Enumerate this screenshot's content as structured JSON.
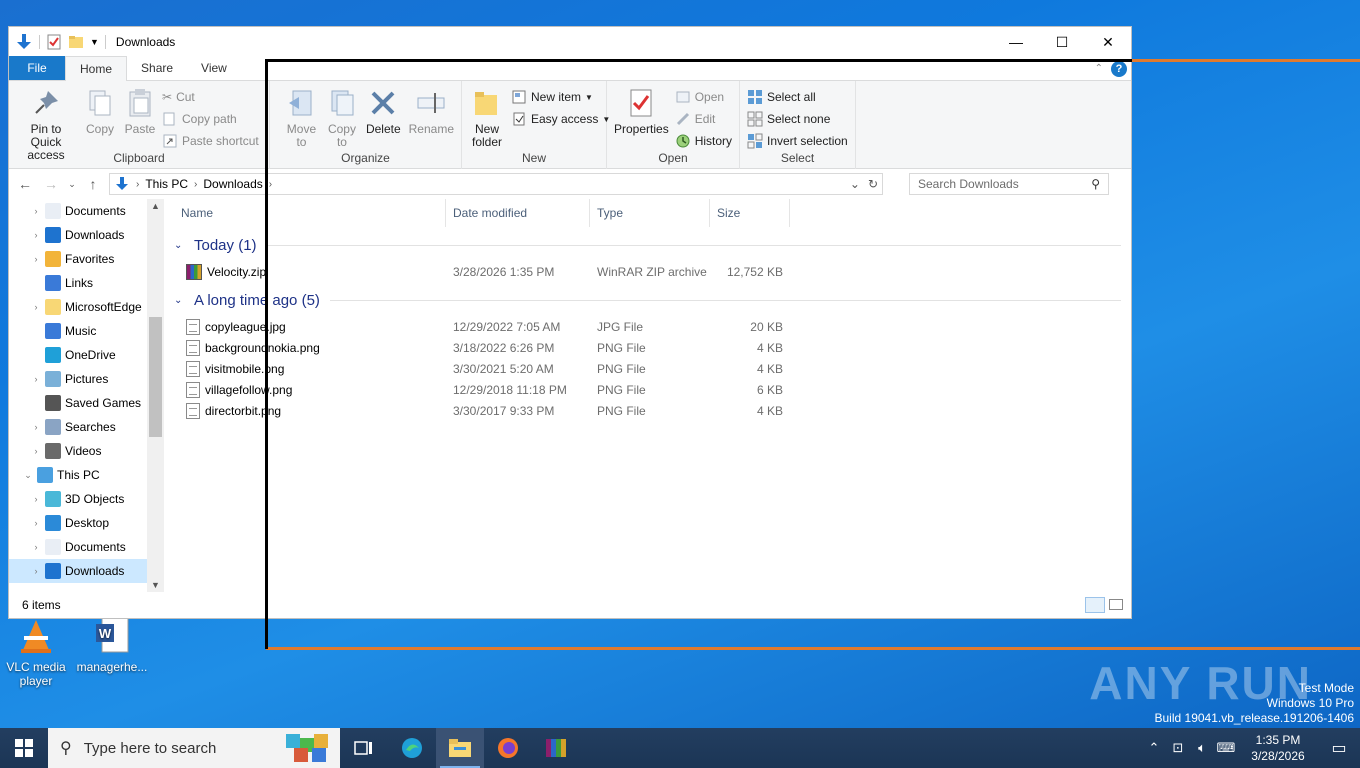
{
  "desktop": {
    "icons": [
      {
        "label": "VLC media player"
      },
      {
        "label": "managerhe..."
      }
    ],
    "watermark": {
      "brand": "ANY RUN",
      "line1": "Test Mode",
      "line2": "Windows 10 Pro",
      "line3": "Build 19041.vb_release.191206-1406"
    }
  },
  "window": {
    "title": "Downloads",
    "controls": {
      "minimize": "—",
      "maximize": "☐",
      "close": "✕"
    },
    "tabs": {
      "file": "File",
      "home": "Home",
      "share": "Share",
      "view": "View"
    },
    "help": "?"
  },
  "ribbon": {
    "clipboard": {
      "label": "Clipboard",
      "pin": "Pin to Quick access",
      "copy": "Copy",
      "paste": "Paste",
      "cut": "Cut",
      "copy_path": "Copy path",
      "paste_shortcut": "Paste shortcut"
    },
    "organize": {
      "label": "Organize",
      "move_to": "Move to",
      "copy_to": "Copy to",
      "delete": "Delete",
      "rename": "Rename"
    },
    "new": {
      "label": "New",
      "new_folder": "New folder",
      "new_item": "New item",
      "easy_access": "Easy access"
    },
    "open": {
      "label": "Open",
      "properties": "Properties",
      "open": "Open",
      "edit": "Edit",
      "history": "History"
    },
    "select": {
      "label": "Select",
      "select_all": "Select all",
      "select_none": "Select none",
      "invert": "Invert selection"
    }
  },
  "address": {
    "crumbs": [
      "This PC",
      "Downloads"
    ],
    "search_placeholder": "Search Downloads"
  },
  "nav": {
    "items": [
      {
        "label": "Documents",
        "expand": "›",
        "indent": 1
      },
      {
        "label": "Downloads",
        "expand": "›",
        "indent": 1
      },
      {
        "label": "Favorites",
        "expand": "›",
        "indent": 1
      },
      {
        "label": "Links",
        "expand": "",
        "indent": 1
      },
      {
        "label": "MicrosoftEdge",
        "expand": "›",
        "indent": 1
      },
      {
        "label": "Music",
        "expand": "",
        "indent": 1
      },
      {
        "label": "OneDrive",
        "expand": "",
        "indent": 1
      },
      {
        "label": "Pictures",
        "expand": "›",
        "indent": 1
      },
      {
        "label": "Saved Games",
        "expand": "",
        "indent": 1
      },
      {
        "label": "Searches",
        "expand": "›",
        "indent": 1
      },
      {
        "label": "Videos",
        "expand": "›",
        "indent": 1
      },
      {
        "label": "This PC",
        "expand": "⌄",
        "indent": 0
      },
      {
        "label": "3D Objects",
        "expand": "›",
        "indent": 1
      },
      {
        "label": "Desktop",
        "expand": "›",
        "indent": 1
      },
      {
        "label": "Documents",
        "expand": "›",
        "indent": 1
      },
      {
        "label": "Downloads",
        "expand": "›",
        "indent": 1
      }
    ]
  },
  "files": {
    "columns": {
      "name": "Name",
      "date": "Date modified",
      "type": "Type",
      "size": "Size"
    },
    "groups": [
      {
        "title": "Today (1)",
        "rows": [
          {
            "name": "Velocity.zip",
            "date": "3/28/2026 1:35 PM",
            "type": "WinRAR ZIP archive",
            "size": "12,752 KB",
            "icon": "zip"
          }
        ]
      },
      {
        "title": "A long time ago (5)",
        "rows": [
          {
            "name": "copyleague.jpg",
            "date": "12/29/2022 7:05 AM",
            "type": "JPG File",
            "size": "20 KB",
            "icon": "file"
          },
          {
            "name": "backgroundnokia.png",
            "date": "3/18/2022 6:26 PM",
            "type": "PNG File",
            "size": "4 KB",
            "icon": "file"
          },
          {
            "name": "visitmobile.png",
            "date": "3/30/2021 5:20 AM",
            "type": "PNG File",
            "size": "4 KB",
            "icon": "file"
          },
          {
            "name": "villagefollow.png",
            "date": "12/29/2018 11:18 PM",
            "type": "PNG File",
            "size": "6 KB",
            "icon": "file"
          },
          {
            "name": "directorbit.png",
            "date": "3/30/2017 9:33 PM",
            "type": "PNG File",
            "size": "4 KB",
            "icon": "file"
          }
        ]
      }
    ]
  },
  "status": {
    "count": "6 items"
  },
  "taskbar": {
    "search_placeholder": "Type here to search",
    "time": "1:35 PM",
    "date": "3/28/2026"
  }
}
